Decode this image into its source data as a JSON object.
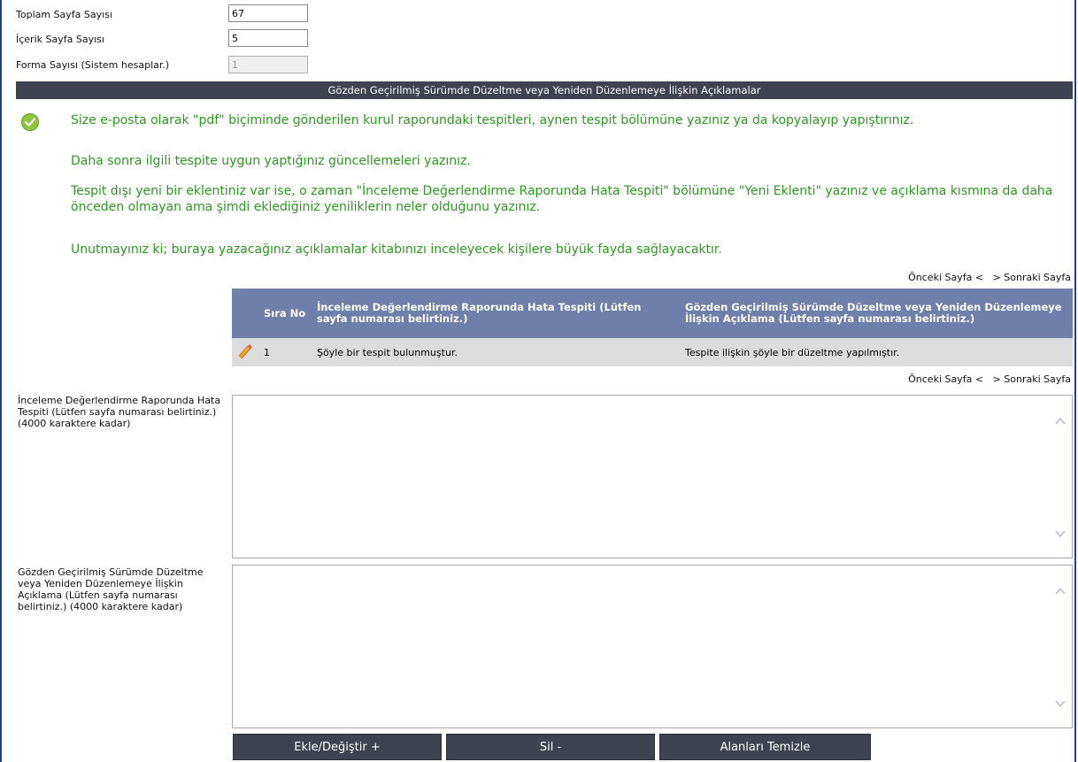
{
  "fields": [
    {
      "label": "Toplam Sayfa Sayısı",
      "value": "67",
      "disabled": false
    },
    {
      "label": "İçerik Sayfa Sayısı",
      "value": "5",
      "disabled": false
    },
    {
      "label": "Forma Sayısı (Sistem hesaplar.)",
      "value": "1",
      "disabled": true
    }
  ],
  "section": {
    "title": "Gözden Geçirilmiş Sürümde Düzeltme veya Yeniden Düzenlemeye İlişkin Açıklamalar"
  },
  "info": {
    "icon": "check-circle-icon",
    "accent": "#2a9a1e",
    "lines": [
      "Size e-posta olarak \"pdf\" biçiminde gönderilen kurul raporundaki tespitleri, aynen tespit bölümüne yazınız ya da kopyalayıp yapıştırınız.",
      "Daha sonra ilgili tespite uygun yaptığınız güncellemeleri yazınız.",
      "Tespit dışı yeni bir eklentiniz var ise, o zaman \"İnceleme Değerlendirme Raporunda Hata Tespiti\" bölümüne \"Yeni Eklenti\" yazınız ve açıklama kısmına da daha önceden olmayan ama şimdi eklediğiniz yeniliklerin neler olduğunu yazınız.",
      "Unutmayınız ki; buraya yazacağınız açıklamalar kitabınızı inceleyecek kişilere büyük fayda sağlayacaktır."
    ]
  },
  "pager": {
    "prev": "Önceki Sayfa <",
    "next": "> Sonraki Sayfa"
  },
  "table": {
    "columns": [
      "Sıra No",
      "İnceleme Değerlendirme Raporunda Hata Tespiti (Lütfen sayfa numarası belirtiniz.)",
      "Gözden Geçirilmiş Sürümde Düzeltme veya Yeniden Düzenlemeye İlişkin Açıklama (Lütfen sayfa numarası belirtiniz.)"
    ],
    "rows": [
      {
        "no": "1",
        "finding": "Şöyle bir tespit bulunmuştur.",
        "fix": "Tespite ilişkin şöyle bir düzeltme yapılmıştır.",
        "edit_icon": "pencil-icon"
      }
    ],
    "header_color": "#6e7faa"
  },
  "textareas": {
    "finding": {
      "label": "İnceleme Değerlendirme Raporunda Hata Tespiti (Lütfen sayfa numarası belirtiniz.) (4000 karaktere kadar)",
      "value": ""
    },
    "fix": {
      "label": "Gözden Geçirilmiş Sürümde Düzeltme veya Yeniden Düzenlemeye İlişkin Açıklama (Lütfen sayfa numarası belirtiniz.) (4000 karaktere kadar)",
      "value": ""
    }
  },
  "buttons": {
    "add": "Ekle/Değiştir +",
    "delete": "Sil -",
    "clear": "Alanları Temizle"
  }
}
